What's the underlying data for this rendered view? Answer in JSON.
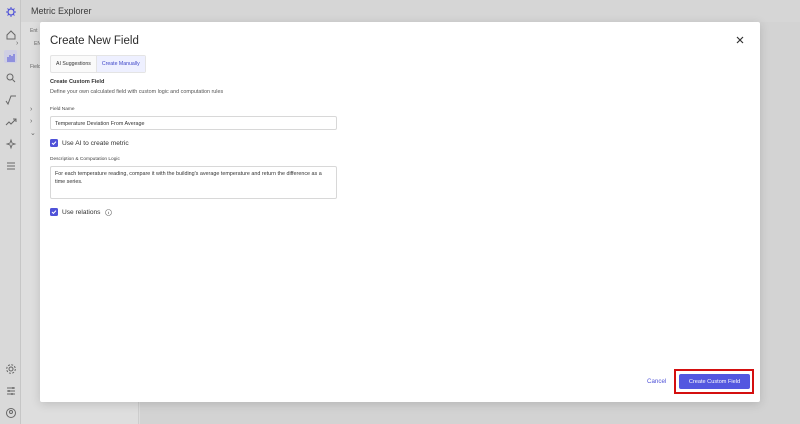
{
  "app": {
    "title": "Metric Explorer",
    "sidepanel_fragments": [
      "Ent",
      "EN",
      "Field"
    ]
  },
  "rail_icons": [
    "logo-icon",
    "home-icon",
    "chart-icon",
    "search-icon",
    "formula-icon",
    "trend-icon",
    "sparkle-icon",
    "list-icon",
    "settings-icon",
    "sliders-icon",
    "user-icon"
  ],
  "modal": {
    "title": "Create New Field",
    "tabs": [
      {
        "label": "AI Suggestions",
        "active": false
      },
      {
        "label": "Create Manually",
        "active": true
      }
    ],
    "section_title": "Create Custom Field",
    "section_desc": "Define your own calculated field with custom logic and computation rules",
    "field_name_label": "Field Name",
    "field_name_value": "Temperature Deviation From Average",
    "use_ai_label": "Use AI to create metric",
    "use_ai_checked": true,
    "logic_label": "Description & Computation Logic",
    "logic_value": "For each temperature reading, compare it with the building's average temperature and return the difference as a time series.",
    "use_relations_label": "Use relations",
    "use_relations_checked": true,
    "cancel_label": "Cancel",
    "create_label": "Create Custom Field"
  },
  "colors": {
    "accent": "#5357e0",
    "highlight_outline": "#d40f0f"
  }
}
